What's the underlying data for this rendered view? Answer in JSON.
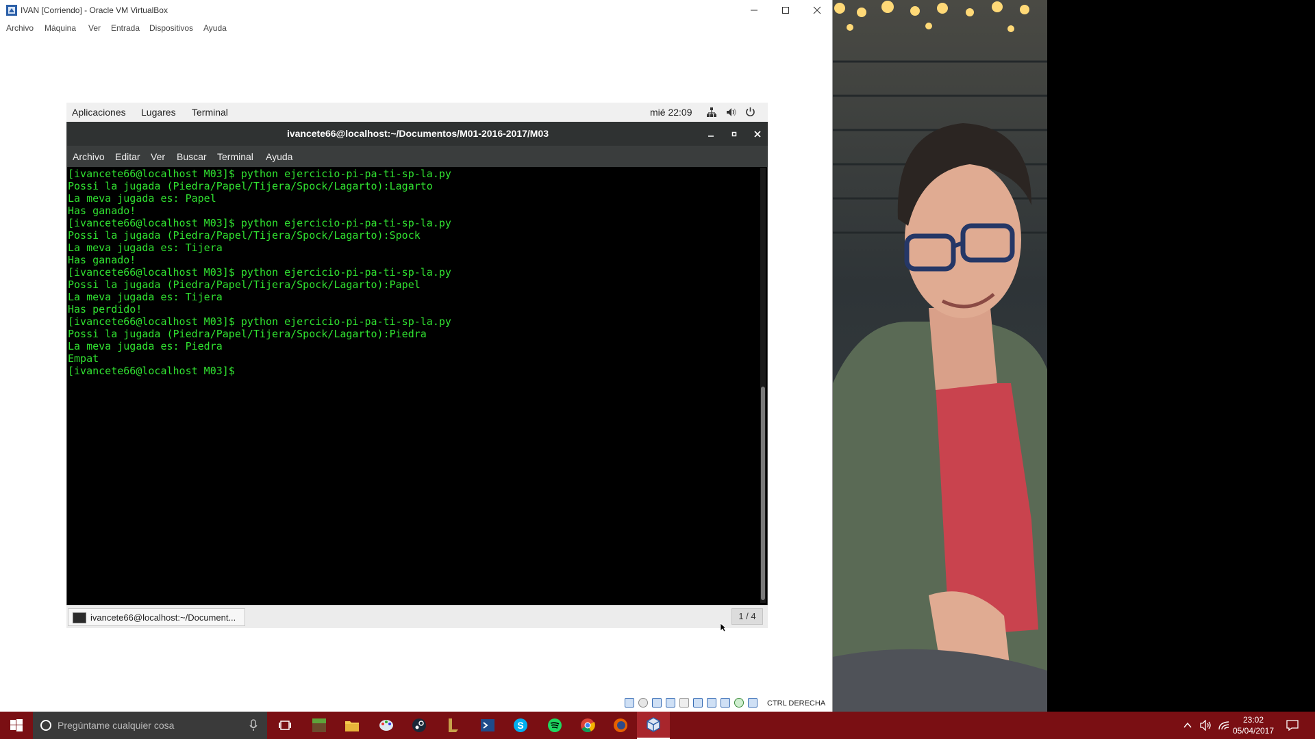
{
  "vbox": {
    "title": "IVAN [Corriendo] - Oracle VM VirtualBox",
    "menu": [
      "Archivo",
      "Máquina",
      "Ver",
      "Entrada",
      "Dispositivos",
      "Ayuda"
    ],
    "host_key": "CTRL DERECHA"
  },
  "gnome": {
    "menu": [
      "Aplicaciones",
      "Lugares",
      "Terminal"
    ],
    "clock": "mié 22:09"
  },
  "terminal": {
    "title": "ivancete66@localhost:~/Documentos/M01-2016-2017/M03",
    "menu": [
      "Archivo",
      "Editar",
      "Ver",
      "Buscar",
      "Terminal",
      "Ayuda"
    ],
    "lines": [
      "[ivancete66@localhost M03]$ python ejercicio-pi-pa-ti-sp-la.py",
      "Possi la jugada (Piedra/Papel/Tijera/Spock/Lagarto):Lagarto",
      "La meva jugada es: Papel",
      "Has ganado!",
      "[ivancete66@localhost M03]$ python ejercicio-pi-pa-ti-sp-la.py",
      "Possi la jugada (Piedra/Papel/Tijera/Spock/Lagarto):Spock",
      "La meva jugada es: Tijera",
      "Has ganado!",
      "[ivancete66@localhost M03]$ python ejercicio-pi-pa-ti-sp-la.py",
      "Possi la jugada (Piedra/Papel/Tijera/Spock/Lagarto):Papel",
      "La meva jugada es: Tijera",
      "Has perdido!",
      "[ivancete66@localhost M03]$ python ejercicio-pi-pa-ti-sp-la.py",
      "Possi la jugada (Piedra/Papel/Tijera/Spock/Lagarto):Piedra",
      "La meva jugada es: Piedra",
      "Empat",
      "[ivancete66@localhost M03]$ "
    ]
  },
  "guest_taskbar": {
    "task_label": "ivancete66@localhost:~/Document...",
    "workspace": "1 / 4"
  },
  "windows_taskbar": {
    "search_placeholder": "Pregúntame cualquier cosa",
    "time": "23:02",
    "date": "05/04/2017",
    "apps": [
      "task-view-icon",
      "minecraft-icon",
      "file-explorer-icon",
      "paint-icon",
      "steam-icon",
      "league-of-legends-icon",
      "powershell-icon",
      "skype-icon",
      "spotify-icon",
      "chrome-icon",
      "firefox-icon",
      "virtualbox-icon"
    ]
  }
}
